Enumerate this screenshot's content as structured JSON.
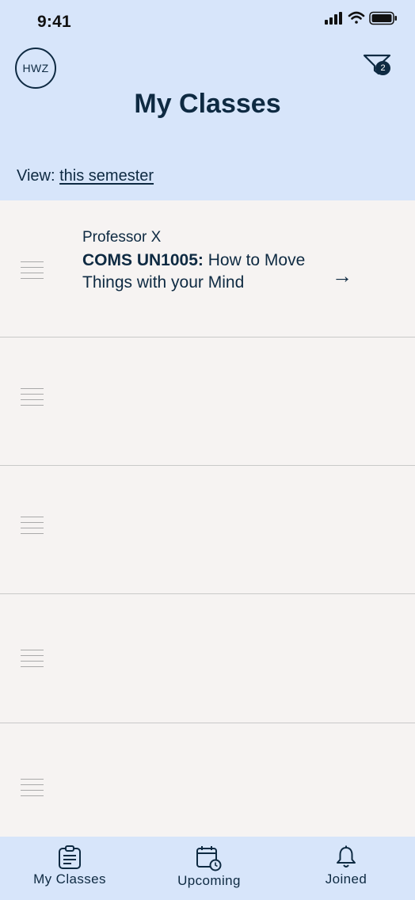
{
  "status_bar": {
    "time": "9:41",
    "icons": [
      "signal-icon",
      "wifi-icon",
      "battery-icon"
    ]
  },
  "header": {
    "avatar_initials": "HWZ",
    "filter_badge_count": "2",
    "title": "My Classes",
    "view_label": "View:",
    "view_value": "this semester"
  },
  "classes": [
    {
      "professor": "Professor X",
      "code": "COMS UN1005:",
      "title": "How to Move Things with your Mind"
    }
  ],
  "tab_bar": {
    "items": [
      {
        "label": "My Classes",
        "icon": "clipboard-icon"
      },
      {
        "label": "Upcoming",
        "icon": "calendar-clock-icon"
      },
      {
        "label": "Joined",
        "icon": "bell-icon"
      }
    ]
  },
  "colors": {
    "header_bg": "#D7E5FA",
    "primary": "#0E2A42",
    "row_bg": "#F6F3F2",
    "divider": "#C9C9C9"
  }
}
